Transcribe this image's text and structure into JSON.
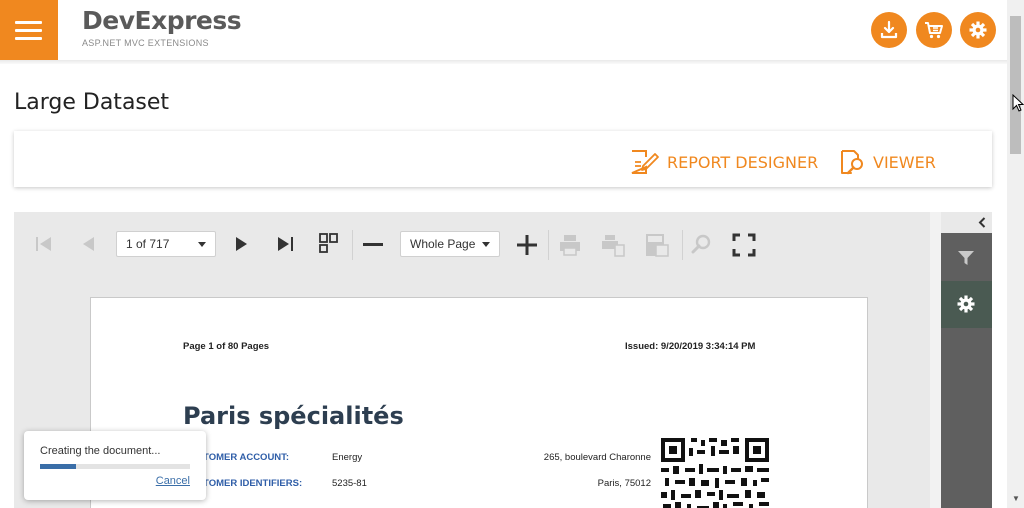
{
  "header": {
    "brand_title": "DevExpress",
    "brand_subtitle": "ASP.NET MVC EXTENSIONS",
    "accent_color": "#f0881f",
    "buttons": [
      "download-icon",
      "cart-icon",
      "gear-icon"
    ]
  },
  "page": {
    "title": "Large Dataset"
  },
  "actions": {
    "report_designer": "REPORT DESIGNER",
    "viewer": "VIEWER"
  },
  "toolbar": {
    "page_value": "1 of 717",
    "zoom_value": "Whole Page"
  },
  "report": {
    "page_info": "Page 1 of 80 Pages",
    "issued": "Issued: 9/20/2019 3:34:14 PM",
    "title": "Paris spécialités",
    "rows": [
      {
        "label": "CUSTOMER ACCOUNT:",
        "value": "Energy",
        "address": "265, boulevard Charonne"
      },
      {
        "label": "CUSTOMER IDENTIFIERS:",
        "value": "5235-81",
        "address": "Paris,  75012"
      }
    ]
  },
  "progress": {
    "text": "Creating the document...",
    "percent": 24,
    "cancel_label": "Cancel"
  }
}
